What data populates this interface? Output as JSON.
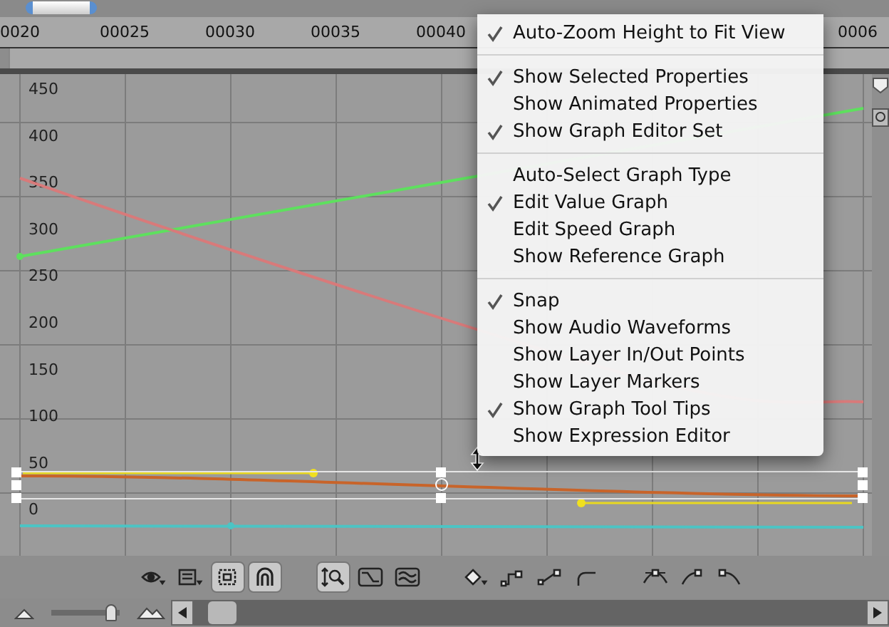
{
  "ruler": {
    "labels": [
      "0020",
      "00025",
      "00030",
      "00035",
      "00040",
      "0006"
    ]
  },
  "graph": {
    "y_labels": [
      "450",
      "400",
      "350",
      "300",
      "250",
      "200",
      "150",
      "100",
      "50",
      "0"
    ],
    "curves": [
      {
        "kind": "rising",
        "color": "#5ee05e"
      },
      {
        "kind": "falling",
        "color": "#d87a7a"
      },
      {
        "kind": "ease",
        "color": "#c8642a"
      },
      {
        "kind": "flat",
        "color": "#4cc4c4"
      }
    ]
  },
  "menu": {
    "sections": [
      [
        {
          "label": "Auto-Zoom Height to Fit View",
          "checked": true
        }
      ],
      [
        {
          "label": "Show Selected Properties",
          "checked": true
        },
        {
          "label": "Show Animated Properties",
          "checked": false
        },
        {
          "label": "Show Graph Editor Set",
          "checked": true
        }
      ],
      [
        {
          "label": "Auto-Select Graph Type",
          "checked": false
        },
        {
          "label": "Edit Value Graph",
          "checked": true
        },
        {
          "label": "Edit Speed Graph",
          "checked": false
        },
        {
          "label": "Show Reference Graph",
          "checked": false
        }
      ],
      [
        {
          "label": "Snap",
          "checked": true
        },
        {
          "label": "Show Audio Waveforms",
          "checked": false
        },
        {
          "label": "Show Layer In/Out Points",
          "checked": false
        },
        {
          "label": "Show Layer Markers",
          "checked": false
        },
        {
          "label": "Show Graph Tool Tips",
          "checked": true
        },
        {
          "label": "Show Expression Editor",
          "checked": false
        }
      ]
    ]
  },
  "toolbar": [
    [
      {
        "kind": "eye",
        "pressed": false
      },
      {
        "kind": "list",
        "pressed": false
      },
      {
        "kind": "frame",
        "pressed": true
      },
      {
        "kind": "snap",
        "pressed": true
      }
    ],
    [
      {
        "kind": "zoom",
        "pressed": true
      },
      {
        "kind": "graph",
        "pressed": false
      },
      {
        "kind": "graph2",
        "pressed": false
      }
    ],
    [
      {
        "kind": "diamond",
        "pressed": false
      },
      {
        "kind": "hold",
        "pressed": false
      },
      {
        "kind": "linear",
        "pressed": false
      },
      {
        "kind": "auto",
        "pressed": false
      }
    ],
    [
      {
        "kind": "easy",
        "pressed": false
      },
      {
        "kind": "easein",
        "pressed": false
      },
      {
        "kind": "easeout",
        "pressed": false
      }
    ]
  ],
  "zoom_slider": {
    "level": 0.95
  }
}
